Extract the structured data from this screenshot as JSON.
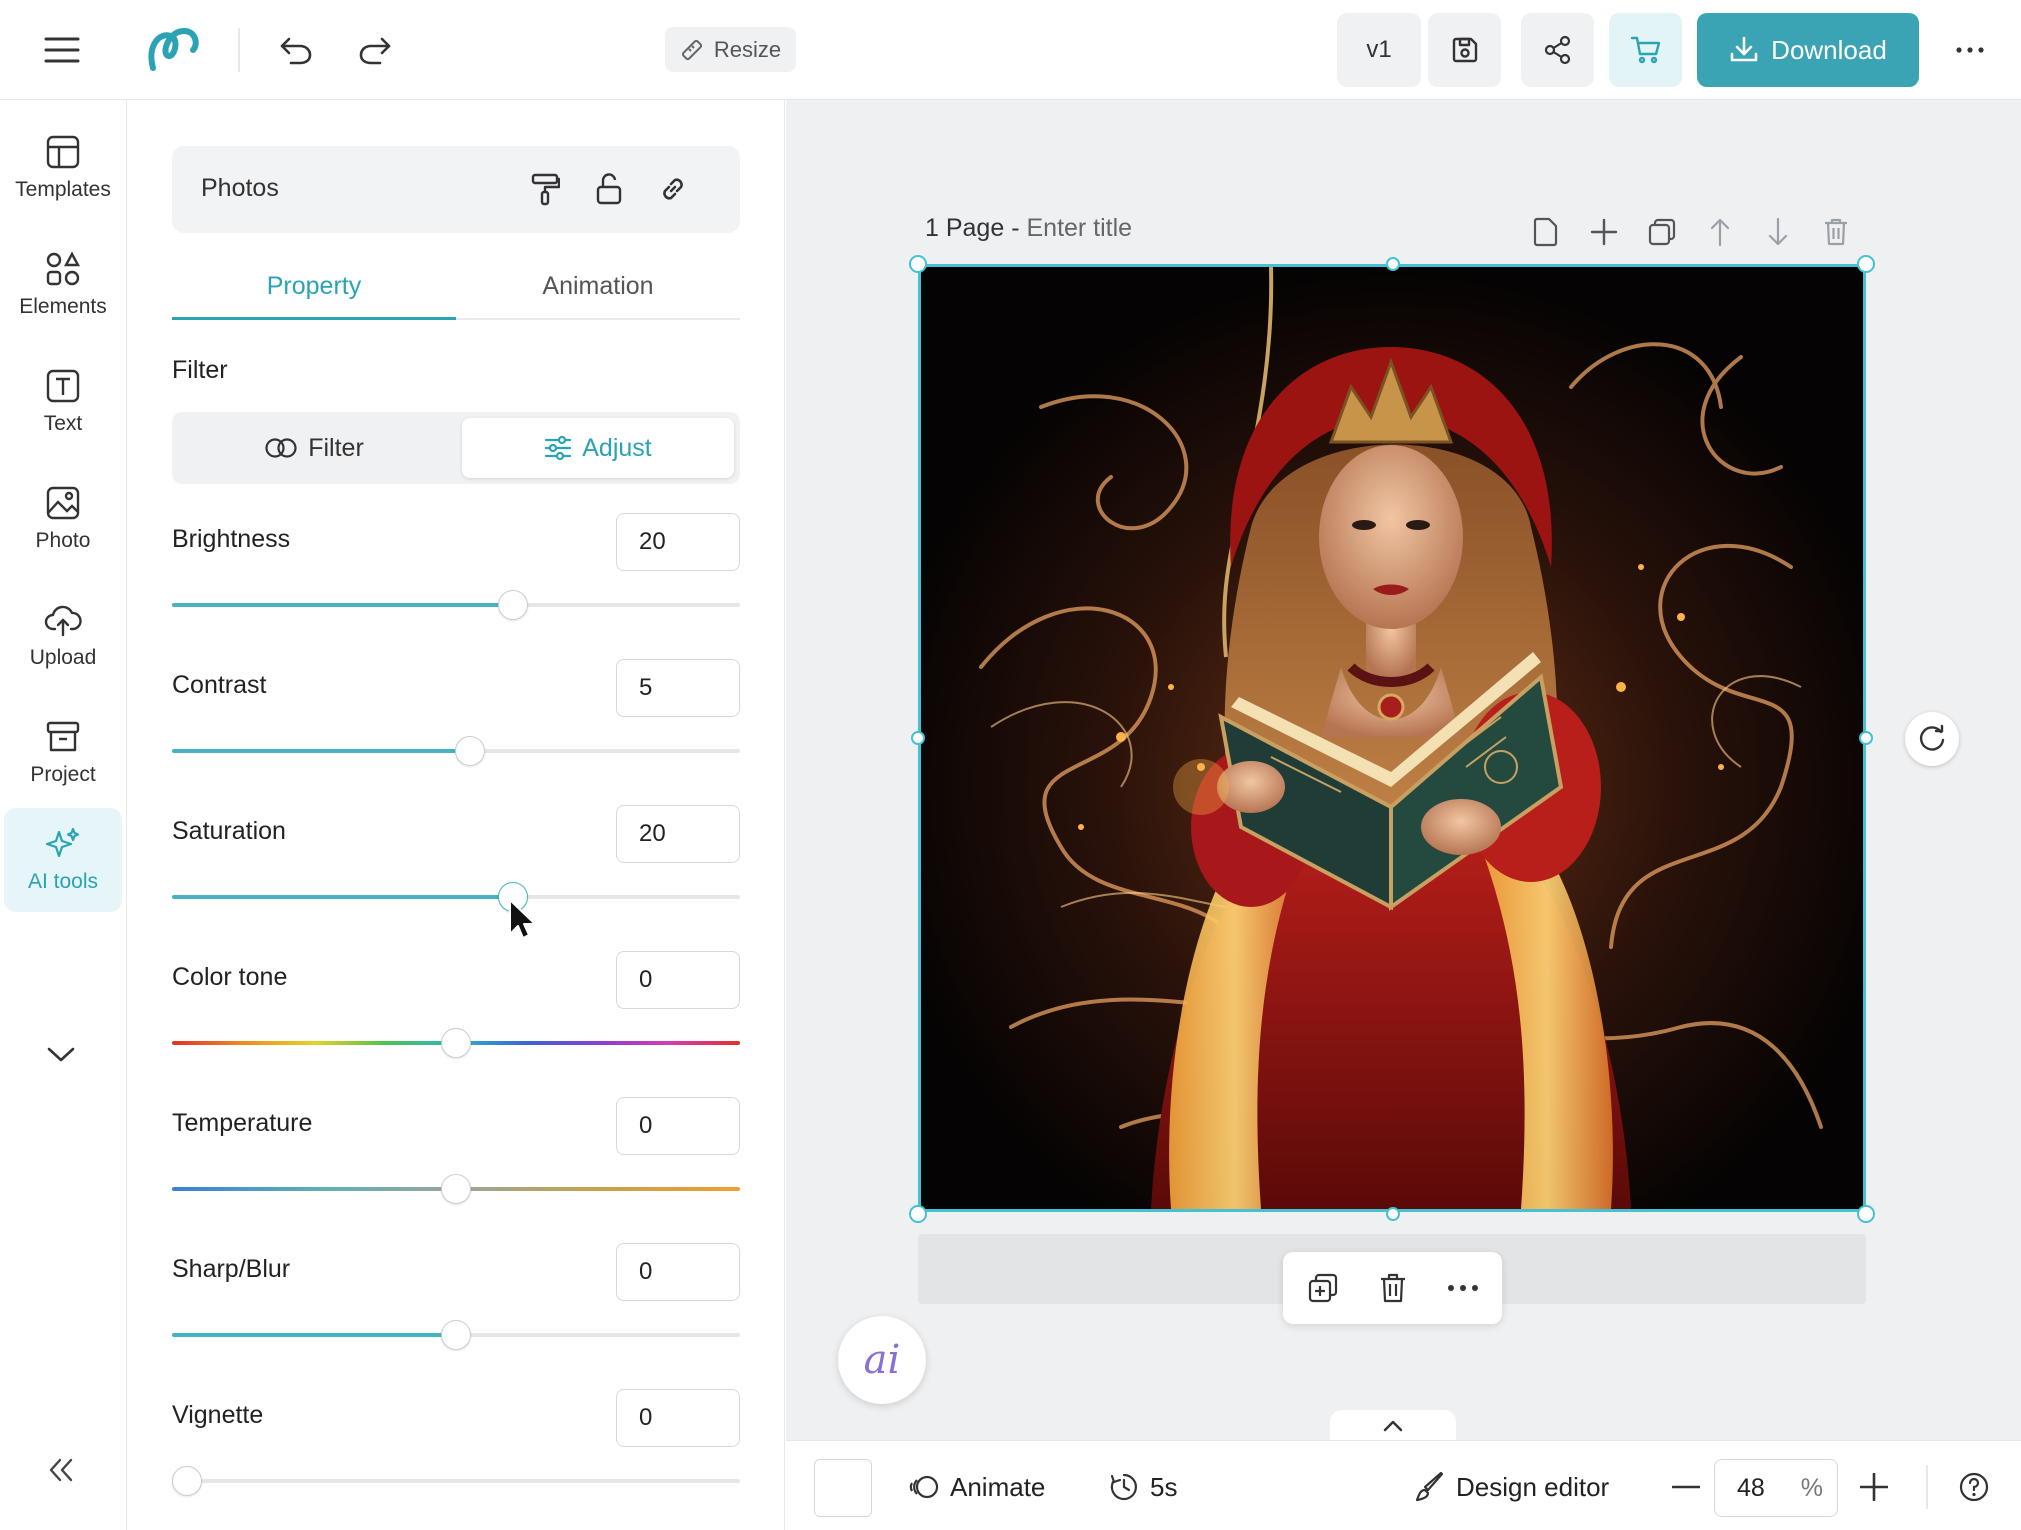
{
  "topbar": {
    "menu_icon": "hamburger-icon",
    "logo_icon": "swirl-logo-icon",
    "undo_icon": "undo-icon",
    "redo_icon": "redo-icon",
    "resize_label": "Resize",
    "version_label": "v1",
    "save_icon": "save-icon",
    "share_icon": "share-icon",
    "cart_icon": "cart-icon",
    "download_label": "Download",
    "more_icon": "more-horizontal-icon"
  },
  "rail": {
    "items": [
      {
        "label": "Templates",
        "icon": "templates-icon"
      },
      {
        "label": "Elements",
        "icon": "elements-icon"
      },
      {
        "label": "Text",
        "icon": "text-icon"
      },
      {
        "label": "Photo",
        "icon": "photo-icon"
      },
      {
        "label": "Upload",
        "icon": "upload-cloud-icon"
      },
      {
        "label": "Project",
        "icon": "project-box-icon"
      },
      {
        "label": "AI tools",
        "icon": "sparkle-icon",
        "active": true
      }
    ],
    "expand_icon": "chevron-down-icon",
    "collapse_icon": "double-chevron-left-icon"
  },
  "panel": {
    "card_title": "Photos",
    "tabs": [
      {
        "label": "Property",
        "active": true
      },
      {
        "label": "Animation",
        "active": false
      }
    ],
    "filter_section_label": "Filter",
    "segment": [
      {
        "label": "Filter",
        "icon": "filter-rings-icon",
        "active": false
      },
      {
        "label": "Adjust",
        "icon": "sliders-icon",
        "active": true
      }
    ],
    "adjustments": [
      {
        "label": "Brightness",
        "value": "20",
        "level": 0.6
      },
      {
        "label": "Contrast",
        "value": "5",
        "level": 0.525
      },
      {
        "label": "Saturation",
        "value": "20",
        "level": 0.6
      },
      {
        "label": "Color tone",
        "value": "0",
        "level": 0.5
      },
      {
        "label": "Temperature",
        "value": "0",
        "level": 0.5
      },
      {
        "label": "Sharp/Blur",
        "value": "0",
        "level": 0.5
      },
      {
        "label": "Vignette",
        "value": "0",
        "level": 0.0
      }
    ]
  },
  "canvas": {
    "page_label": "1 Page",
    "separator": "-",
    "title_placeholder": "Enter title",
    "selection_color": "#44c1d2"
  },
  "bottombar": {
    "animate_label": "Animate",
    "duration_label": "5s",
    "design_editor_label": "Design editor",
    "zoom_value": "48",
    "zoom_unit": "%"
  },
  "colors": {
    "accent": "#2aa3b3",
    "download_bg": "#3aa3b4",
    "workspace_bg": "#eef0f2"
  }
}
